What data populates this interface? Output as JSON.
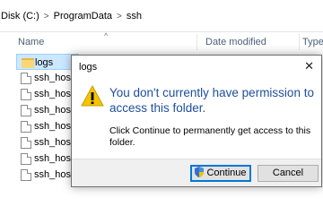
{
  "address": {
    "crumbs": [
      "Disk (C:)",
      "ProgramData",
      "ssh"
    ],
    "separator": ">"
  },
  "columns": {
    "name": "Name",
    "date_modified": "Date modified",
    "type": "Type"
  },
  "files": [
    {
      "name": "logs",
      "kind": "folder",
      "selected": true
    },
    {
      "name": "ssh_host_",
      "kind": "file"
    },
    {
      "name": "ssh_host_",
      "kind": "file"
    },
    {
      "name": "ssh_host_",
      "kind": "file"
    },
    {
      "name": "ssh_host_",
      "kind": "file"
    },
    {
      "name": "ssh_host_",
      "kind": "file"
    },
    {
      "name": "ssh_host_",
      "kind": "file"
    },
    {
      "name": "ssh_host_",
      "kind": "file"
    }
  ],
  "dialog": {
    "title": "logs",
    "close_glyph": "✕",
    "heading": "You don't currently have permission to access this folder.",
    "body": "Click Continue to permanently get access to this folder.",
    "continue_label": "Continue",
    "cancel_label": "Cancel"
  },
  "colors": {
    "heading": "#1e4e9c",
    "selection": "#cce8ff",
    "accent": "#0078d7",
    "warning": "#f5c400"
  }
}
